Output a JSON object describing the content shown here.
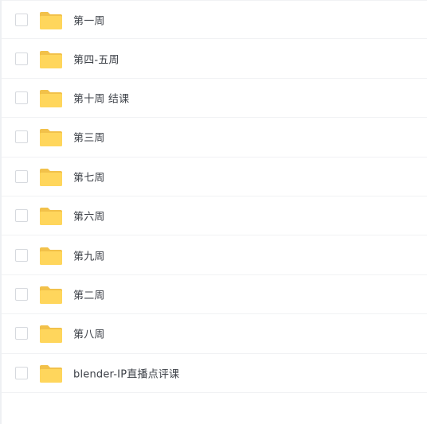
{
  "colors": {
    "folder_front": "#ffd65c",
    "folder_back": "#f2c14a",
    "text": "#3d4148",
    "divider": "#f1f2f4",
    "checkbox_border": "#d6d9de"
  },
  "file_list": {
    "items": [
      {
        "name": "第一周",
        "type": "folder",
        "icon": "folder-icon",
        "checked": false
      },
      {
        "name": "第四-五周",
        "type": "folder",
        "icon": "folder-icon",
        "checked": false
      },
      {
        "name": "第十周 结课",
        "type": "folder",
        "icon": "folder-icon",
        "checked": false
      },
      {
        "name": "第三周",
        "type": "folder",
        "icon": "folder-icon",
        "checked": false
      },
      {
        "name": "第七周",
        "type": "folder",
        "icon": "folder-icon",
        "checked": false
      },
      {
        "name": "第六周",
        "type": "folder",
        "icon": "folder-icon",
        "checked": false
      },
      {
        "name": "第九周",
        "type": "folder",
        "icon": "folder-icon",
        "checked": false
      },
      {
        "name": "第二周",
        "type": "folder",
        "icon": "folder-icon",
        "checked": false
      },
      {
        "name": "第八周",
        "type": "folder",
        "icon": "folder-icon",
        "checked": false
      },
      {
        "name": "blender-IP直播点评课",
        "type": "folder",
        "icon": "folder-icon",
        "checked": false
      }
    ]
  }
}
